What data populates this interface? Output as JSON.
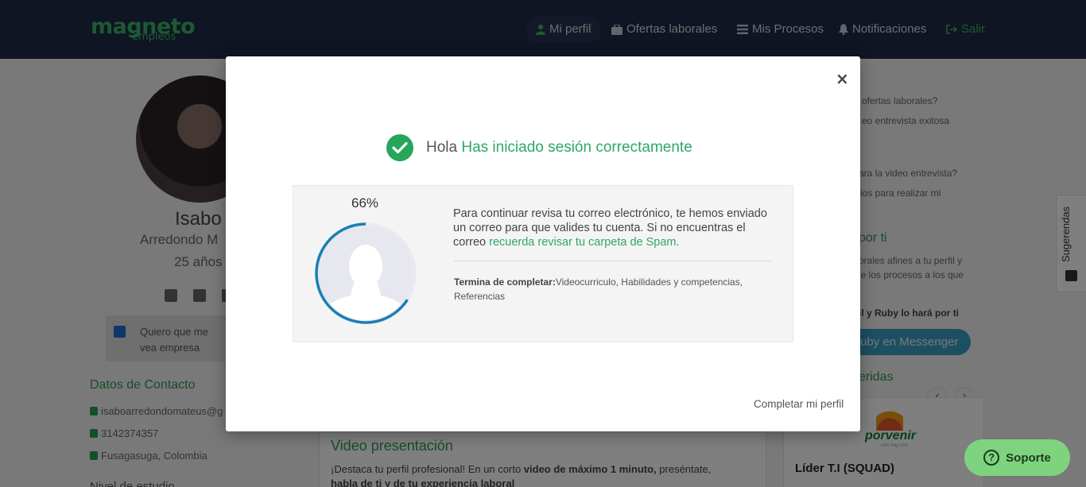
{
  "navbar": {
    "logo_main": "magneto",
    "logo_sub": "empleos",
    "items": [
      {
        "label": "Mi perfil",
        "icon": "user-icon"
      },
      {
        "label": "Ofertas laborales",
        "icon": "briefcase-icon"
      },
      {
        "label": "Mis Procesos",
        "icon": "list-icon"
      },
      {
        "label": "Notificaciones",
        "icon": "bell-icon"
      },
      {
        "label": "Salir",
        "icon": "sign-out-icon"
      }
    ]
  },
  "profile_bg": {
    "name": "Isabo",
    "surname": "Arredondo M",
    "age": "25 años",
    "visibility_text": "Quiero que me vea empresa",
    "contact_title": "Datos de Contacto",
    "email": "isaboarredondomateus@g",
    "phone": "3142374357",
    "location": "Fusagasuga, Colombia",
    "next_section": "Nivel de estudio"
  },
  "video_section": {
    "title": "Video presentación",
    "text_part1": "¡Destaca tu perfil profesional! En un corto ",
    "text_bold": "video de máximo 1 minuto,",
    "text_part2": " preséntate,",
    "text_line2": "habla de ti y de tu experiencia laboral"
  },
  "right_bg": {
    "line1": "ofertas laborales?",
    "line2": "eo entrevista exitosa",
    "line3": "ara la video entrevista?",
    "line4": "ios para realizar mi",
    "heading": "por ti",
    "line5": "orales afines a tu perfil y",
    "line6": "le los procesos a los que",
    "bold_line": "il y Ruby lo hará por ti",
    "ruby_button": "uby en Messenger",
    "suggest_heading": "eridas",
    "prev_arrow": "‹",
    "next_arrow": "›",
    "company": "porvenir",
    "company_sub": "sólo hay uno",
    "job_title": "Líder T.I (SQUAD)"
  },
  "side_tab": {
    "label": "Sugerendas"
  },
  "support": {
    "label": "Soporte"
  },
  "modal": {
    "close": "×",
    "greeting": "Hola",
    "success_text": "Has iniciado sesión correctamente",
    "progress_label": "66%",
    "progress_value": 0.66,
    "message_part1": "Para continuar revisa tu correo electrónico, te hemos enviado un correo para que valides tu cuenta. Si no encuentras el correo ",
    "message_link": "recuerda revisar tu carpeta de Spam.",
    "pending_label": "Termina de completar:",
    "pending_items": "Videocurriculo, Habilidades y competencias, Referencias",
    "complete_link": "Completar mi perfil"
  },
  "colors": {
    "navbar": "#1f2a44",
    "accent_green": "#2ea866",
    "progress_ring": "#1a7fb5"
  }
}
